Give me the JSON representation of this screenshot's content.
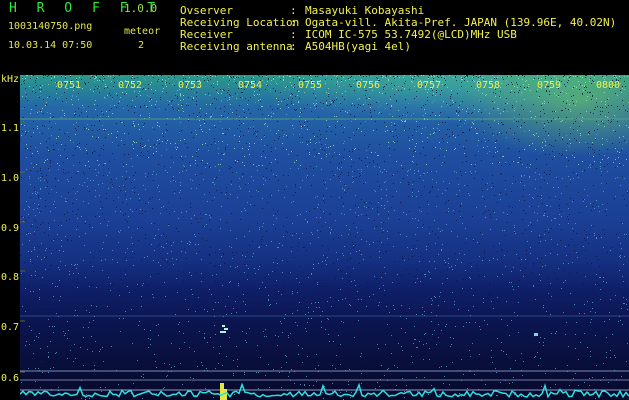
{
  "header": {
    "app_name": "H R O F F T",
    "version": "1.0.0",
    "file_name": "1003140750.png",
    "datetime": "10.03.14 07:50",
    "type_label": "meteor",
    "count": "2",
    "meta": [
      {
        "label": "Ovserver",
        "value": "Masayuki Kobayashi"
      },
      {
        "label": "Receiving Location",
        "value": "Ogata-vill. Akita-Pref. JAPAN (139.96E, 40.02N)"
      },
      {
        "label": "Receiver",
        "value": "ICOM IC-575 53.7492(@LCD)MHz USB"
      },
      {
        "label": "Receiving antenna",
        "value": "A504HB(yagi 4el)"
      }
    ],
    "separator": ":"
  },
  "spectrogram": {
    "y_unit": "kHz",
    "y_ticks": [
      "1.1",
      "1.0",
      "0.9",
      "0.8",
      "0.7",
      "0.6"
    ],
    "time_ticks": [
      "0751",
      "0752",
      "0753",
      "0754",
      "0755",
      "0756",
      "0757",
      "0758",
      "0759",
      "0800"
    ]
  },
  "colors": {
    "label": "#f0f04a",
    "app_name": "#2ee83a",
    "noise_bright": "#6fd8b0",
    "echo": "#e6e640"
  }
}
